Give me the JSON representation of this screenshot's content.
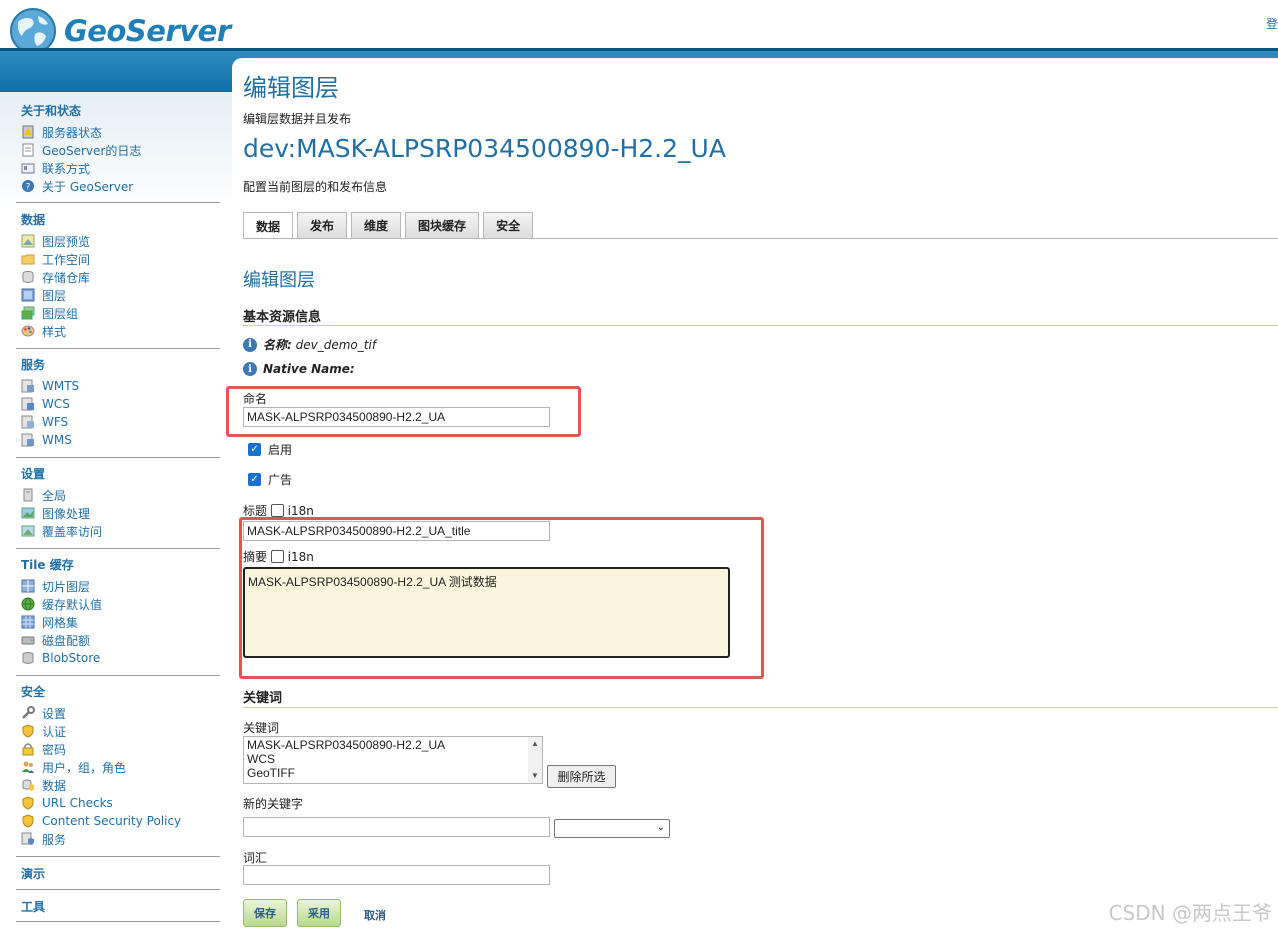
{
  "header": {
    "logo_text": "GeoServer",
    "login_text": "登"
  },
  "sidebar": {
    "sections": [
      {
        "title": "关于和状态",
        "items": [
          {
            "label": "服务器状态",
            "icon": "server-status-icon"
          },
          {
            "label": "GeoServer的日志",
            "icon": "log-file-icon"
          },
          {
            "label": "联系方式",
            "icon": "contact-card-icon"
          },
          {
            "label": "关于 GeoServer",
            "icon": "about-icon"
          }
        ]
      },
      {
        "title": "数据",
        "items": [
          {
            "label": "图层预览",
            "icon": "layer-preview-icon"
          },
          {
            "label": "工作空间",
            "icon": "workspace-folder-icon"
          },
          {
            "label": "存储仓库",
            "icon": "store-database-icon"
          },
          {
            "label": "图层",
            "icon": "layer-icon"
          },
          {
            "label": "图层组",
            "icon": "layer-group-icon"
          },
          {
            "label": "样式",
            "icon": "style-palette-icon"
          }
        ]
      },
      {
        "title": "服务",
        "items": [
          {
            "label": "WMTS",
            "icon": "wmts-service-icon"
          },
          {
            "label": "WCS",
            "icon": "wcs-service-icon"
          },
          {
            "label": "WFS",
            "icon": "wfs-service-icon"
          },
          {
            "label": "WMS",
            "icon": "wms-service-icon"
          }
        ]
      },
      {
        "title": "设置",
        "items": [
          {
            "label": "全局",
            "icon": "global-settings-icon"
          },
          {
            "label": "图像处理",
            "icon": "image-processing-icon"
          },
          {
            "label": "覆盖率访问",
            "icon": "coverage-access-icon"
          }
        ]
      },
      {
        "title": "Tile 缓存",
        "items": [
          {
            "label": "切片图层",
            "icon": "tile-layers-icon"
          },
          {
            "label": "缓存默认值",
            "icon": "cache-defaults-globe-icon"
          },
          {
            "label": "网格集",
            "icon": "gridset-icon"
          },
          {
            "label": "磁盘配额",
            "icon": "disk-quota-icon"
          },
          {
            "label": "BlobStore",
            "icon": "blobstore-icon"
          }
        ]
      },
      {
        "title": "安全",
        "items": [
          {
            "label": "设置",
            "icon": "security-settings-wrench-icon"
          },
          {
            "label": "认证",
            "icon": "authentication-shield-icon"
          },
          {
            "label": "密码",
            "icon": "password-lock-icon"
          },
          {
            "label": "用户，组，角色",
            "icon": "users-groups-icon"
          },
          {
            "label": "数据",
            "icon": "data-security-icon"
          },
          {
            "label": "URL Checks",
            "icon": "url-checks-shield-icon"
          },
          {
            "label": "Content Security Policy",
            "icon": "csp-shield-icon"
          },
          {
            "label": "服务",
            "icon": "service-security-icon"
          }
        ]
      },
      {
        "title": "演示",
        "items": []
      },
      {
        "title": "工具",
        "items": []
      }
    ]
  },
  "main": {
    "page_title": "编辑图层",
    "page_subtitle": "编辑层数据并且发布",
    "layer_name": "dev:MASK-ALPSRP034500890-H2.2_UA",
    "layer_subtitle": "配置当前图层的和发布信息",
    "tabs": [
      "数据",
      "发布",
      "维度",
      "图块缓存",
      "安全"
    ],
    "edit_heading": "编辑图层",
    "basic_info_heading": "基本资源信息",
    "name_info_label": "名称:",
    "name_info_value": "dev_demo_tif",
    "native_name_label": "Native Name:",
    "naming_label": "命名",
    "naming_value": "MASK-ALPSRP034500890-H2.2_UA",
    "enabled_label": "启用",
    "advertised_label": "广告",
    "title_label": "标题",
    "i18n_label": "i18n",
    "title_value": "MASK-ALPSRP034500890-H2.2_UA_title",
    "abstract_label": "摘要",
    "abstract_value": "MASK-ALPSRP034500890-H2.2_UA 测试数据",
    "keywords_heading": "关键词",
    "keywords_label": "关键词",
    "keywords": [
      "MASK-ALPSRP034500890-H2.2_UA",
      "WCS",
      "GeoTIFF"
    ],
    "remove_selected_label": "删除所选",
    "new_keyword_label": "新的关键字",
    "new_keyword_value": "",
    "language_value": "",
    "vocabulary_label": "词汇",
    "vocabulary_value": "",
    "save_label": "保存",
    "apply_label": "采用",
    "cancel_label": "取消"
  },
  "watermark": "CSDN @两点王爷",
  "colors": {
    "accent": "#1f6fa8",
    "topbar": "#0d6fa6",
    "highlight_border": "#e25555",
    "textarea_bg": "#fbf5dc",
    "green_button": "#b8d98d"
  }
}
